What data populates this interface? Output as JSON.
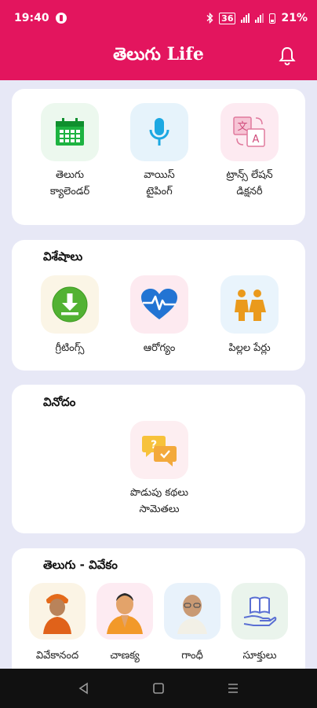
{
  "status": {
    "time": "19:40",
    "battery": "21%",
    "network": "36"
  },
  "app": {
    "title": "తెలుగు Life"
  },
  "card1": {
    "items": [
      {
        "label1": "తెలుగు",
        "label2": "క్యాలెండర్",
        "icon": "calendar-icon"
      },
      {
        "label1": "వాయిస్",
        "label2": "టైపింగ్",
        "icon": "microphone-icon"
      },
      {
        "label1": "ట్రాన్స్ లేషన్",
        "label2": "డిక్షనరీ",
        "icon": "translate-icon"
      }
    ]
  },
  "card2": {
    "title": "విశేషాలు",
    "items": [
      {
        "label": "గ్రీటింగ్స్",
        "icon": "download-icon"
      },
      {
        "label": "ఆరోగ్యం",
        "icon": "heartbeat-icon"
      },
      {
        "label": "పిల్లల పేర్లు",
        "icon": "children-icon"
      }
    ]
  },
  "card3": {
    "title": "వినోదం",
    "item": {
      "label1": "పొడుపు కథలు",
      "label2": "సామెతలు",
      "icon": "chat-question-icon"
    }
  },
  "card4": {
    "title": "తెలుగు - వివేకం",
    "items": [
      {
        "label": "వివేకానంద",
        "icon": "vivekananda-portrait"
      },
      {
        "label": "చాణక్య",
        "icon": "chanakya-portrait"
      },
      {
        "label": "గాంధీ",
        "icon": "gandhi-portrait"
      },
      {
        "label": "సూక్తులు",
        "icon": "book-hand-icon"
      }
    ]
  },
  "colors": {
    "primary": "#e3155e",
    "background": "#e7e8f6"
  }
}
